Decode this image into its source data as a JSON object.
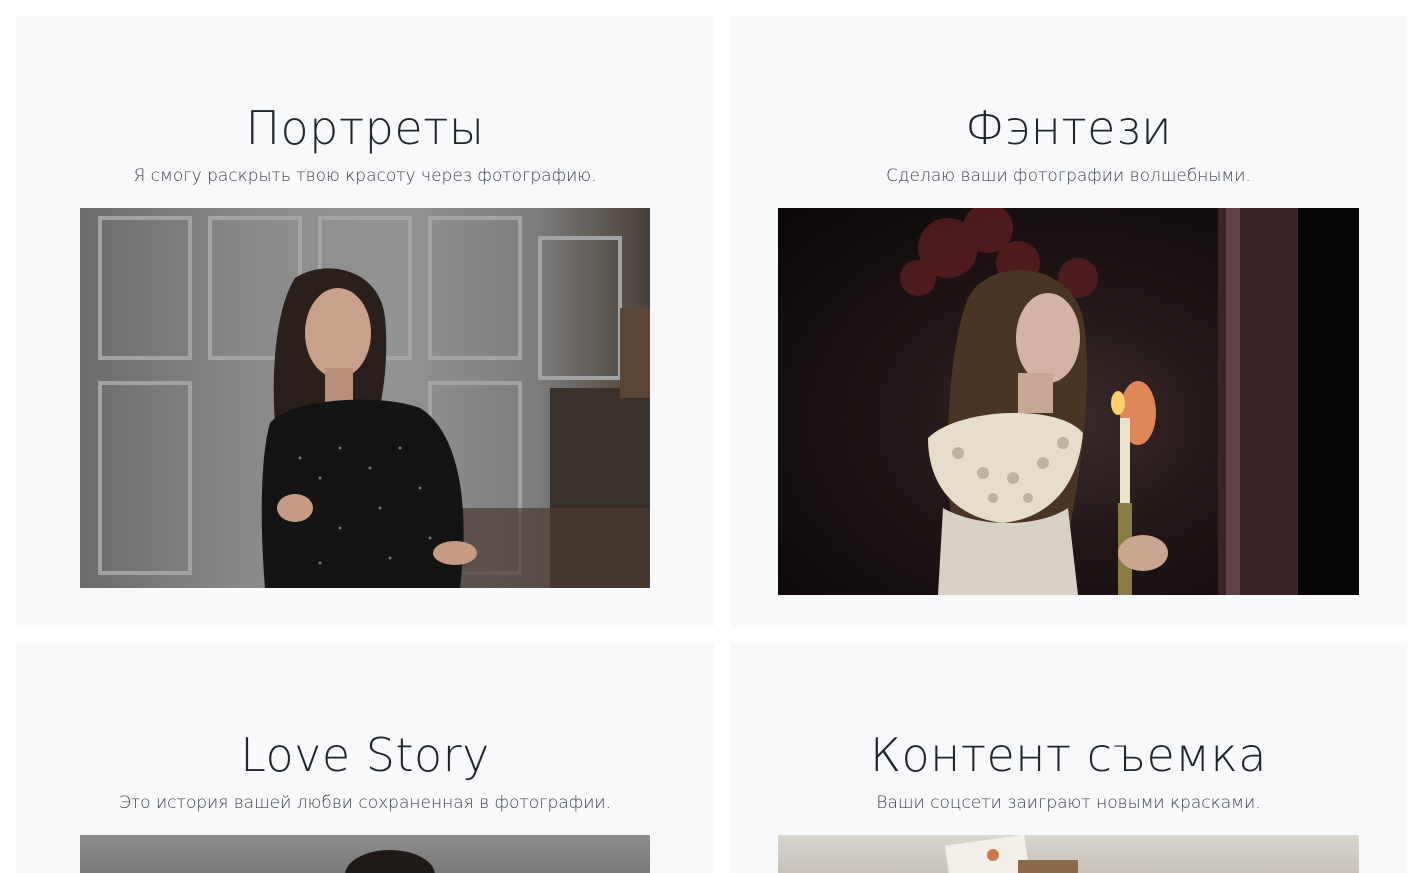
{
  "services": [
    {
      "title": "Портреты",
      "subtitle": "Я смогу раскрыть твою красоту через фотографию.",
      "image_desc": "portrait-photo"
    },
    {
      "title": "Фэнтези",
      "subtitle": "Сделаю ваши фотографии волшебными.",
      "image_desc": "fantasy-photo"
    },
    {
      "title": "Love Story",
      "subtitle": "Это история вашей любви сохраненная в фотографии.",
      "image_desc": "love-story-photo"
    },
    {
      "title": "Контент съемка",
      "subtitle": "Ваши соцсети заиграют новыми красками.",
      "image_desc": "content-photo"
    }
  ],
  "colors": {
    "card_background": "#f8f9fa",
    "title": "#212529",
    "subtitle": "#3d4146"
  }
}
